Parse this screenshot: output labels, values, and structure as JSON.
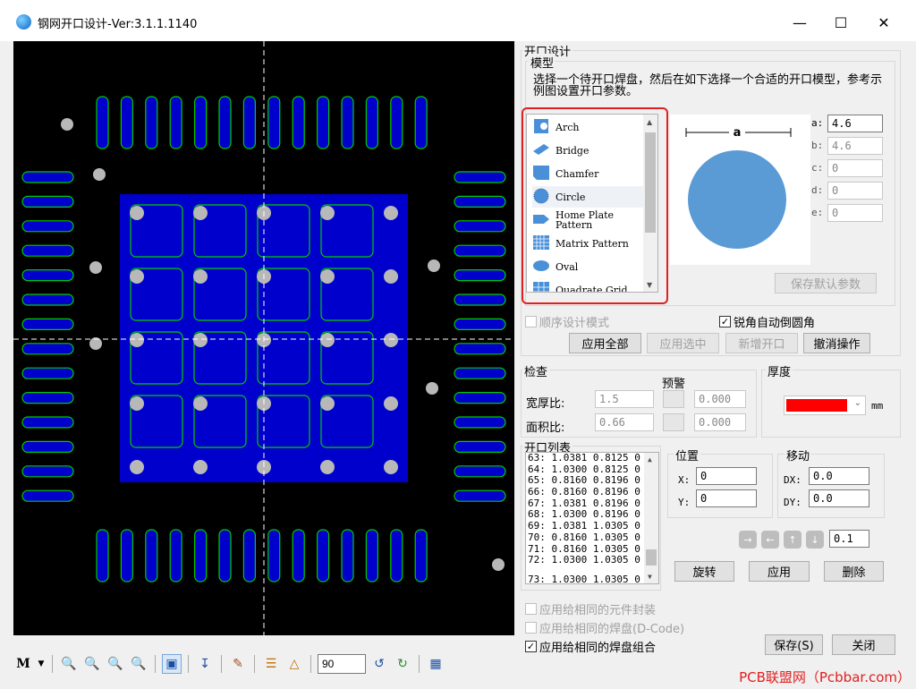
{
  "window": {
    "title": "钢网开口设计-Ver:3.1.1.1140",
    "min_icon": "minimize-icon",
    "max_icon": "maximize-icon",
    "close_icon": "close-icon"
  },
  "toolbar": {
    "rotation_value": "90"
  },
  "aperture_design": {
    "group_title": "开口设计",
    "model_group": "模型",
    "instruction": [
      "选择一个待开口焊盘，然后在如下选择一个合适的开口模型，参考示",
      "例图设置开口参数。"
    ],
    "models": [
      {
        "label": "Arch",
        "icon": "arch-icon"
      },
      {
        "label": "Bridge",
        "icon": "bridge-icon"
      },
      {
        "label": "Chamfer",
        "icon": "chamfer-icon"
      },
      {
        "label": "Circle",
        "icon": "circle-icon",
        "selected": true
      },
      {
        "label": "Home Plate\nPattern",
        "icon": "home-plate-icon"
      },
      {
        "label": "Matrix Pattern",
        "icon": "matrix-icon"
      },
      {
        "label": "Oval",
        "icon": "oval-icon"
      },
      {
        "label": "Quadrate Grid",
        "icon": "quadrate-grid-icon"
      }
    ],
    "preview_label": "a",
    "params": [
      {
        "name": "a:",
        "value": "4.6",
        "active": true
      },
      {
        "name": "b:",
        "value": "4.6",
        "active": false
      },
      {
        "name": "c:",
        "value": "0",
        "active": false
      },
      {
        "name": "d:",
        "value": "0",
        "active": false
      },
      {
        "name": "e:",
        "value": "0",
        "active": false
      }
    ],
    "save_default": "保存默认参数",
    "sequential_mode": "顺序设计模式",
    "auto_round": "锐角自动倒圆角",
    "buttons": {
      "apply_all": "应用全部",
      "apply_selected": "应用选中",
      "add_aperture": "新增开口",
      "undo": "撤消操作"
    }
  },
  "check": {
    "title": "检查",
    "warning": "预警",
    "aspect_label": "宽厚比:",
    "aspect_value": "1.5",
    "aspect_warn": "0.000",
    "area_label": "面积比:",
    "area_value": "0.66",
    "area_warn": "0.000"
  },
  "thickness": {
    "title": "厚度",
    "unit": "mm",
    "color": "#ff0000"
  },
  "aperture_list": {
    "title": "开口列表",
    "rows": [
      "63: 1.0381 0.8125 0",
      "64: 1.0300 0.8125 0",
      "65: 0.8160 0.8196 0",
      "66: 0.8160 0.8196 0",
      "67: 1.0381 0.8196 0",
      "68: 1.0300 0.8196 0",
      "69: 1.0381 1.0305 0",
      "70: 0.8160 1.0305 0",
      "71: 0.8160 1.0305 0",
      "72: 1.0300 1.0305 0",
      "73: 1.0300 1.0305 0"
    ]
  },
  "position": {
    "title": "位置",
    "x_label": "X:",
    "x_value": "0",
    "y_label": "Y:",
    "y_value": "0"
  },
  "move": {
    "title": "移动",
    "dx_label": "DX:",
    "dx_value": "0.0",
    "dy_label": "DY:",
    "dy_value": "0.0",
    "step_value": "0.1"
  },
  "actions": {
    "rotate": "旋转",
    "apply": "应用",
    "delete": "删除",
    "save": "保存(S)",
    "close": "关闭"
  },
  "apply_options": {
    "same_package": "应用给相同的元件封装",
    "same_dcode": "应用给相同的焊盘(D-Code)",
    "same_combo": "应用给相同的焊盘组合"
  },
  "watermark": "PCB联盟网（Pcbbar.com）",
  "colors": {
    "canvas_bg": "#000000",
    "pad_fill": "#0000cc",
    "pad_outline": "#00cc00",
    "selection": "#e02020"
  }
}
